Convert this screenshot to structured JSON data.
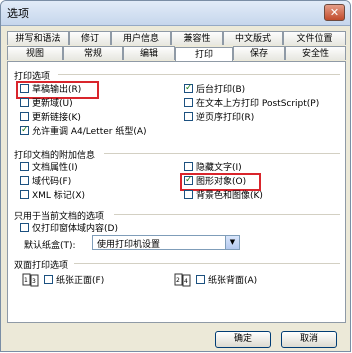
{
  "window": {
    "title": "选项",
    "close_glyph": "✕"
  },
  "tabs_row1": [
    "拼写和语法",
    "修订",
    "用户信息",
    "兼容性",
    "中文版式",
    "文件位置"
  ],
  "tabs_row2": [
    "视图",
    "常规",
    "编辑",
    "打印",
    "保存",
    "安全性"
  ],
  "active_tab": "打印",
  "print_options": {
    "heading": "打印选项",
    "left": [
      {
        "label": "草稿输出(R)",
        "checked": false
      },
      {
        "label": "更新域(U)",
        "checked": false
      },
      {
        "label": "更新链接(K)",
        "checked": false
      },
      {
        "label": "允许重调 A4/Letter 纸型(A)",
        "checked": true
      }
    ],
    "right": [
      {
        "label": "后台打印(B)",
        "checked": true
      },
      {
        "label": "在文本上方打印 PostScript(P)",
        "checked": false
      },
      {
        "label": "逆页序打印(R)",
        "checked": false
      }
    ]
  },
  "attached_info": {
    "heading": "打印文档的附加信息",
    "left": [
      {
        "label": "文档属性(I)",
        "checked": false
      },
      {
        "label": "域代码(F)",
        "checked": false
      },
      {
        "label": "XML 标记(X)",
        "checked": false
      }
    ],
    "right": [
      {
        "label": "隐藏文字(I)",
        "checked": false
      },
      {
        "label": "图形对象(O)",
        "checked": true
      },
      {
        "label": "背景色和图像(K)",
        "checked": false
      }
    ]
  },
  "current_doc": {
    "heading": "只用于当前文档的选项",
    "option": {
      "label": "仅打印窗体域内容(D)",
      "checked": false
    }
  },
  "tray": {
    "label": "默认纸盒(T):",
    "value": "使用打印机设置"
  },
  "duplex": {
    "heading": "双面打印选项",
    "front": {
      "label": "纸张正面(F)",
      "checked": false
    },
    "back": {
      "label": "纸张背面(A)",
      "checked": false
    }
  },
  "buttons": {
    "ok": "确定",
    "cancel": "取消"
  },
  "colors": {
    "highlight": "#d9252c",
    "panel": "#ffffff",
    "dialog": "#ece9d8"
  }
}
